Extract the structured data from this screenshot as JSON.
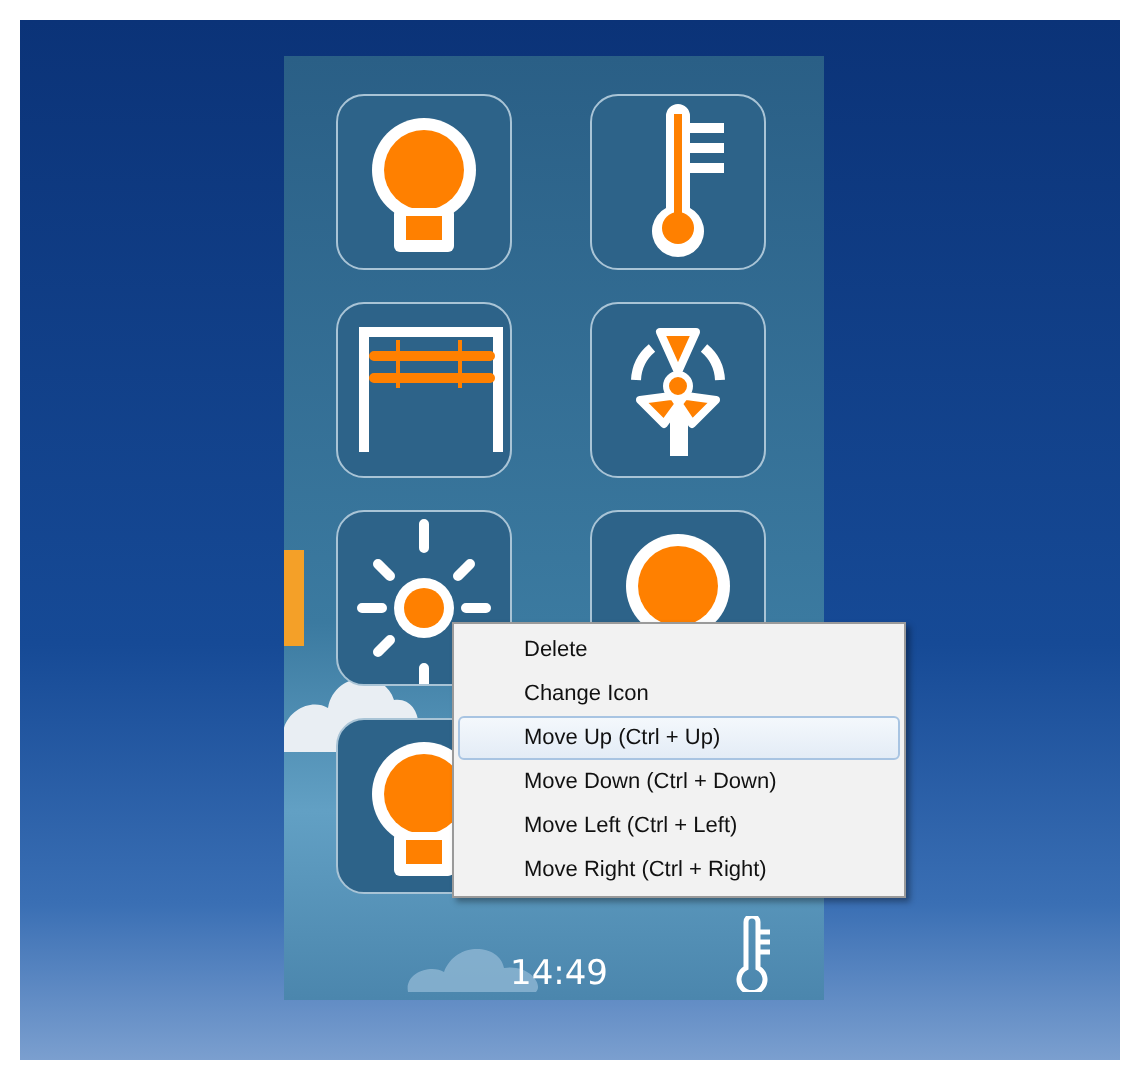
{
  "tiles": [
    {
      "kind": "bulb"
    },
    {
      "kind": "thermometer"
    },
    {
      "kind": "gate"
    },
    {
      "kind": "fan"
    },
    {
      "kind": "sun"
    },
    {
      "kind": "bulb"
    },
    {
      "kind": "bulb"
    }
  ],
  "context_menu": {
    "items": [
      {
        "label": "Delete",
        "selected": false
      },
      {
        "label": "Change Icon",
        "selected": false
      },
      {
        "label": "Move Up (Ctrl + Up)",
        "selected": true
      },
      {
        "label": "Move Down (Ctrl + Down)",
        "selected": false
      },
      {
        "label": "Move Left (Ctrl + Left)",
        "selected": false
      },
      {
        "label": "Move Right (Ctrl + Right)",
        "selected": false
      }
    ]
  },
  "footer": {
    "time": "14:49"
  }
}
